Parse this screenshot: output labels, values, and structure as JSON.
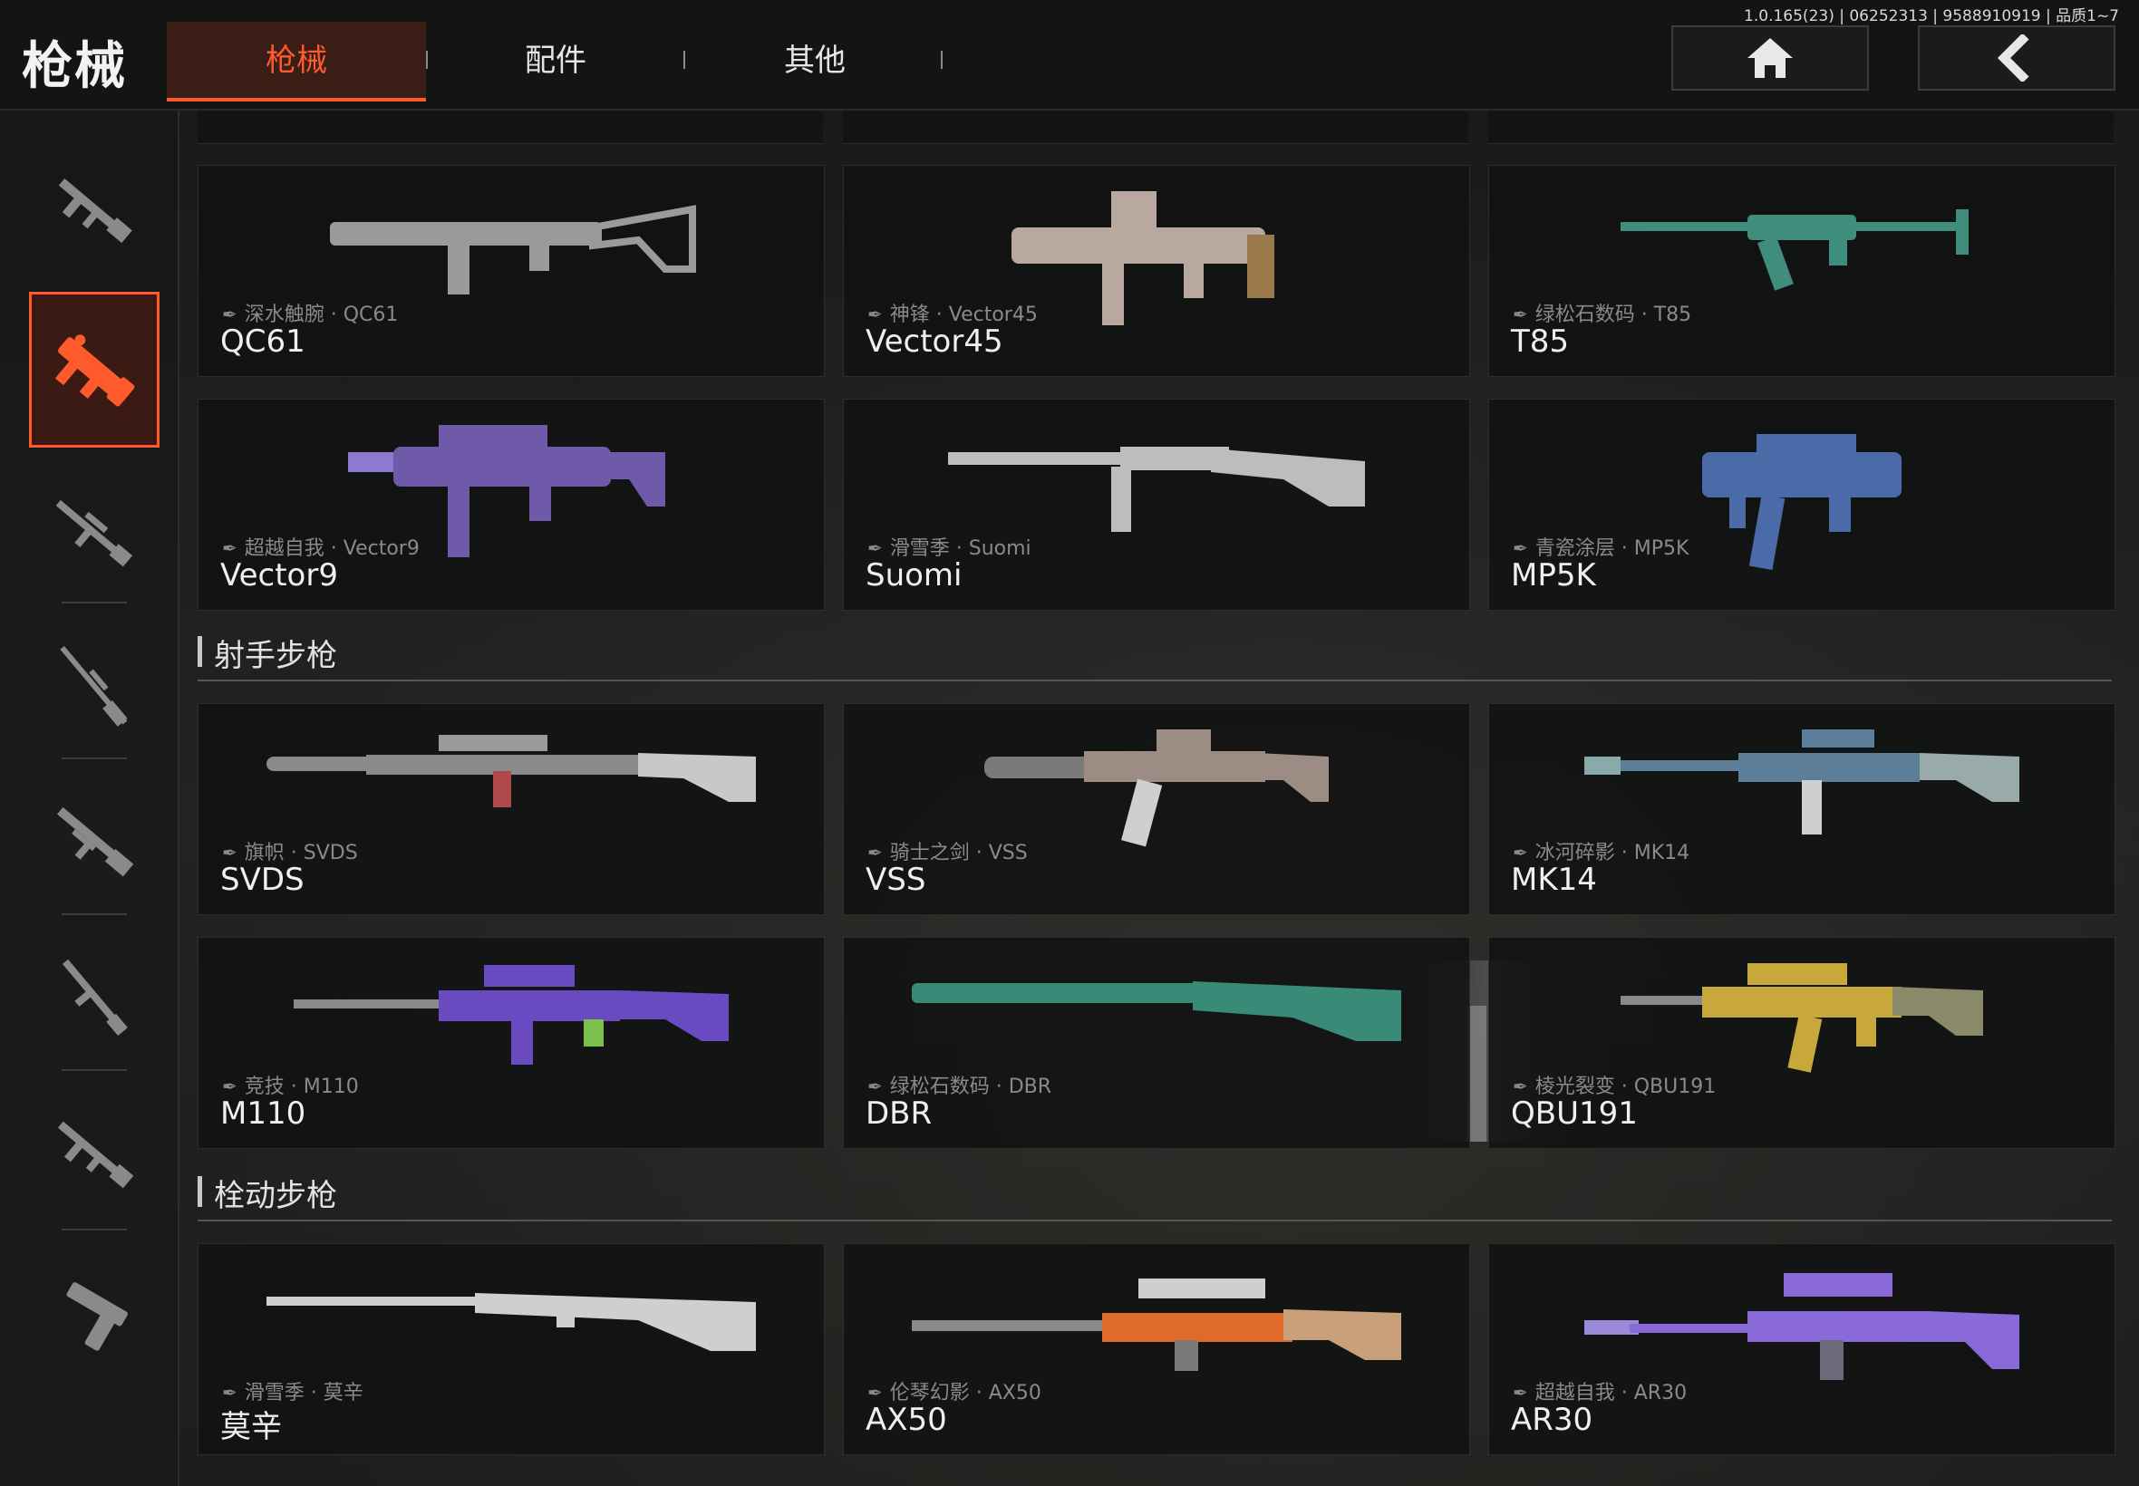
{
  "header": {
    "title": "枪械",
    "tabs": [
      {
        "label": "枪械",
        "active": true
      },
      {
        "label": "配件",
        "active": false
      },
      {
        "label": "其他",
        "active": false
      }
    ],
    "build_info": "1.0.165(23) | 06252313 | 9588910919 | 品质1~7",
    "home_icon": "home-icon",
    "back_icon": "chevron-left-icon"
  },
  "sidebar": {
    "items": [
      {
        "icon": "assault-rifle-icon",
        "active": false
      },
      {
        "icon": "smg-icon",
        "active": true
      },
      {
        "icon": "marksman-rifle-icon",
        "active": false
      },
      {
        "icon": "sniper-rifle-icon",
        "active": false
      },
      {
        "icon": "shotgun-icon",
        "active": false
      },
      {
        "icon": "lmg-icon",
        "active": false
      },
      {
        "icon": "carbine-icon",
        "active": false
      },
      {
        "icon": "pistol-icon",
        "active": false
      }
    ],
    "accent": "#ff5a2c"
  },
  "sections": [
    {
      "label": "",
      "cards": [
        {
          "skin": "深水触腕 · QC61",
          "name": "QC61",
          "color": "#9a9a9a"
        },
        {
          "skin": "神锋 · Vector45",
          "name": "Vector45",
          "color": "#b8a8a0"
        },
        {
          "skin": "绿松石数码 · T85",
          "name": "T85",
          "color": "#3f8d7c"
        },
        {
          "skin": "超越自我 · Vector9",
          "name": "Vector9",
          "color": "#6e5aa8"
        },
        {
          "skin": "滑雪季 · Suomi",
          "name": "Suomi",
          "color": "#bdbdbd"
        },
        {
          "skin": "青瓷涂层 · MP5K",
          "name": "MP5K",
          "color": "#4a6aa8"
        }
      ]
    },
    {
      "label": "射手步枪",
      "cards": [
        {
          "skin": "旗帜 · SVDS",
          "name": "SVDS",
          "color": "#b04a4a"
        },
        {
          "skin": "骑士之剑 · VSS",
          "name": "VSS",
          "color": "#9c8c84"
        },
        {
          "skin": "冰河碎影 · MK14",
          "name": "MK14",
          "color": "#5c7e98"
        },
        {
          "skin": "竞技 · M110",
          "name": "M110",
          "color": "#6a4ac0"
        },
        {
          "skin": "绿松石数码 · DBR",
          "name": "DBR",
          "color": "#3a8a78"
        },
        {
          "skin": "棱光裂变 · QBU191",
          "name": "QBU191",
          "color": "#c8a83a"
        }
      ]
    },
    {
      "label": "栓动步枪",
      "cards": [
        {
          "skin": "滑雪季 · 莫辛",
          "name": "莫辛",
          "color": "#cfcfcf"
        },
        {
          "skin": "伦琴幻影 · AX50",
          "name": "AX50",
          "color": "#e06a2a"
        },
        {
          "skin": "超越自我 · AR30",
          "name": "AR30",
          "color": "#8a6ad8"
        }
      ]
    }
  ]
}
